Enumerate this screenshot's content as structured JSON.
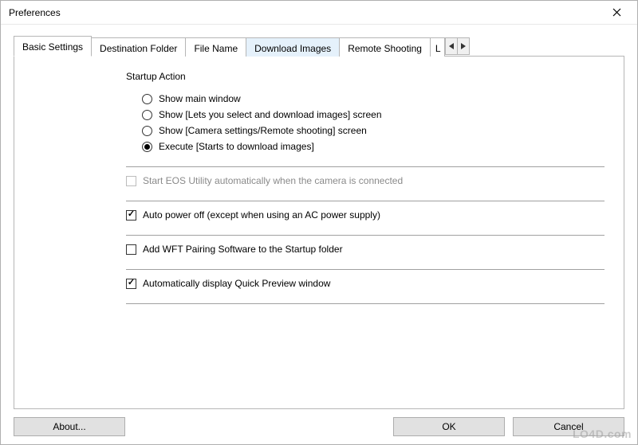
{
  "window": {
    "title": "Preferences"
  },
  "tabs": {
    "items": [
      {
        "label": "Basic Settings",
        "active": true
      },
      {
        "label": "Destination Folder"
      },
      {
        "label": "File Name"
      },
      {
        "label": "Download Images",
        "hover": true
      },
      {
        "label": "Remote Shooting"
      },
      {
        "label": "L",
        "partial": true
      }
    ]
  },
  "startup": {
    "heading": "Startup Action",
    "options": [
      {
        "label": "Show main window",
        "selected": false
      },
      {
        "label": "Show [Lets you select and download images] screen",
        "selected": false
      },
      {
        "label": "Show [Camera settings/Remote shooting] screen",
        "selected": false
      },
      {
        "label": "Execute [Starts to download images]",
        "selected": true
      }
    ]
  },
  "checks": {
    "auto_start": {
      "label": "Start EOS Utility automatically when the camera is connected",
      "checked": false,
      "disabled": true
    },
    "auto_power_off": {
      "label": "Auto power off (except when using an AC power supply)",
      "checked": true,
      "disabled": false
    },
    "wft_pairing": {
      "label": "Add WFT Pairing Software to the Startup folder",
      "checked": false,
      "disabled": false
    },
    "quick_preview": {
      "label": "Automatically display Quick Preview window",
      "checked": true,
      "disabled": false
    }
  },
  "buttons": {
    "about": "About...",
    "ok": "OK",
    "cancel": "Cancel"
  },
  "watermark": "LO4D.com"
}
